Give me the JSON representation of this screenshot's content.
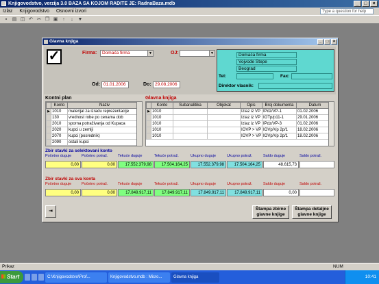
{
  "app": {
    "title": "Knjigovodstvo, verzija 3.0     BAZA SA KOJOM RADITE JE: RadnaBaza.mdb",
    "menu": [
      "Izlaz",
      "Knjigovodstvo",
      "Osnovni izvori"
    ],
    "help_placeholder": "Type a question for help"
  },
  "toolbar": {
    "icons": [
      "save-icon",
      "print-icon",
      "preview-icon",
      "undo-icon",
      "cut-icon",
      "copy-icon",
      "paste-icon",
      "sort-asc-icon",
      "sort-desc-icon",
      "filter-icon"
    ]
  },
  "form": {
    "title": "Glavna knjiga",
    "firma_label": "Firma:",
    "firma_value": "Domaća firma",
    "oj_label": "OJ:",
    "oj_value": "",
    "od_label": "Od:",
    "od_value": "01.01.2006",
    "do_label": "Do:",
    "do_value": "29.08.2006",
    "company": {
      "name": "Domaća firma",
      "address": "Vojvode Stepe",
      "city": "Beograd",
      "tel_label": "Tel:",
      "fax_label": "Fax:",
      "owner_label": "Direktor vlasnik:"
    }
  },
  "kontni_plan": {
    "title": "Kontni plan",
    "columns": [
      "Konto",
      "Naziv"
    ],
    "rows": [
      [
        "1010",
        "materijal za izradu reprezentacije"
      ],
      [
        "130",
        "vrednost robe po cenama dob"
      ],
      [
        "2010",
        "sporna potraživanja od Kupaca"
      ],
      [
        "2020",
        "kupci u zemlji"
      ],
      [
        "2070",
        "kupci (posrednik)"
      ],
      [
        "2090",
        "ostali kupci"
      ]
    ]
  },
  "glavna_knjiga": {
    "title": "Glavna knjiga",
    "columns": [
      "Konto",
      "Subanalitika",
      "Objekat",
      "Opis",
      "Broj dokumenta",
      "Datum"
    ],
    "rows": [
      [
        "1010",
        "",
        "",
        "Izlaz iz VP",
        "IPdz/VP-1",
        "01.02.2006"
      ],
      [
        "1010",
        "",
        "",
        "Izlaz iz VP",
        "IOTp/p11-1",
        "29.01.2006"
      ],
      [
        "1010",
        "",
        "",
        "Izlaz iz VP",
        "IPdz/VP-3",
        "01.02.2006"
      ],
      [
        "1010",
        "",
        "",
        "IOVP > VP",
        "IOVp/Vp 2p/1",
        "18.02.2006"
      ],
      [
        "1010",
        "",
        "",
        "IOVP > VP",
        "IOVp/Vp 2p/1",
        "18.02.2006"
      ]
    ]
  },
  "sum_selected": {
    "title": "Zbir stavki za selektovani konto",
    "headers": [
      "Početno duguje",
      "Početno potraž.",
      "Tekuće duguje",
      "Tekuće potraž.",
      "Ukupno duguje",
      "Ukupno potraž.",
      "Saldo duguje",
      "Saldo potraž."
    ],
    "values": [
      "0,00",
      "0,00",
      "17.552.379,98",
      "17.504.164,25",
      "17.552.379,98",
      "17.504.164,25",
      "48.615,73",
      ""
    ]
  },
  "sum_all": {
    "title": "Zbir stavki za sva konta",
    "headers": [
      "Početno duguje",
      "Početno potraž.",
      "Tekuće duguje",
      "Tekuće potraž.",
      "Ukupno duguje",
      "Ukupno potraž.",
      "Saldo duguje",
      "Saldo potraž."
    ],
    "values": [
      "0,00",
      "0,00",
      "17.849.917,11",
      "17.849.917,11",
      "17.849.917,11",
      "17.849.917,11",
      "0,00",
      ""
    ]
  },
  "buttons": {
    "print_summary": "Štampa zbirne glavne knjige",
    "print_detail": "Štampa detaljne glavne knjige"
  },
  "status": {
    "left": "Prikaz",
    "num": "NUM"
  },
  "taskbar": {
    "start": "Start",
    "tasks": [
      "C:\\Knjigovodstvo\\Prof...",
      "Knjigovodstvo.mdb : Micro...",
      "Glavna knjiga"
    ],
    "clock": "10:41"
  }
}
